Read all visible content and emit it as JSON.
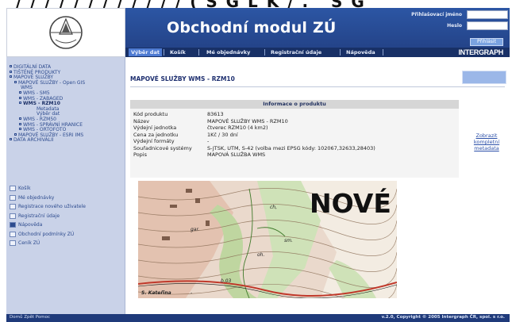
{
  "banner": {
    "text": "/ / / / / / / / / / / / ( S G L K / .   S G"
  },
  "app": {
    "title": "Obchodní modul ZÚ",
    "brand": "INTERGRAPH"
  },
  "login": {
    "username_label": "Přihlašovací jméno",
    "password_label": "Heslo",
    "submit_label": "Přihlásit"
  },
  "nav": {
    "items": [
      {
        "label": "Výběr dat",
        "active": true
      },
      {
        "label": "Košík"
      },
      {
        "label": "Mé objednávky"
      },
      {
        "label": "Registrační údaje"
      },
      {
        "label": "Nápověda"
      }
    ]
  },
  "sidebar": {
    "tree": [
      {
        "label": "DIGITÁLNÍ DATA"
      },
      {
        "label": "TIŠTĚNÉ PRODUKTY"
      },
      {
        "label": "MAPOVÉ SLUŽBY"
      },
      {
        "label": "MAPOVÉ SLUŽBY - Open GIS"
      },
      {
        "label": "WMS"
      },
      {
        "label": "WMS - SM5"
      },
      {
        "label": "WMS - ZABAGED"
      },
      {
        "label": "WMS - RZM10"
      },
      {
        "label": "Metadata"
      },
      {
        "label": "Výběr dat"
      },
      {
        "label": "WMS - RZM50"
      },
      {
        "label": "WMS - SPRÁVNÍ HRANICE"
      },
      {
        "label": "WMS - ORTOFOTO"
      },
      {
        "label": "MAPOVÉ SLUŽBY - ESRI IMS"
      },
      {
        "label": "DATA ARCHIVÁLIÍ"
      }
    ],
    "links": [
      {
        "label": "Košík"
      },
      {
        "label": "Mé objednávky"
      },
      {
        "label": "Registrace nového uživatele"
      },
      {
        "label": "Registrační údaje"
      },
      {
        "label": "Nápověda"
      },
      {
        "label": "Obchodní podmínky ZÚ"
      },
      {
        "label": "Ceník ZÚ"
      }
    ]
  },
  "main": {
    "page_title": "MAPOVÉ SLUŽBY WMS - RZM10",
    "info_header": "Informace o produktu",
    "rows": [
      {
        "key": "Kód produktu",
        "value": "83613"
      },
      {
        "key": "Název",
        "value": "MAPOVÉ SLUŽBY WMS - RZM10"
      },
      {
        "key": "Výdejní jednotka",
        "value": "čtverec RZM10 (4 km2)"
      },
      {
        "key": "Cena za jednotku",
        "value": "1Kč / 30 dní"
      },
      {
        "key": "Výdejní formáty",
        "value": "-"
      },
      {
        "key": "Souřadnicové systémy",
        "value": "S-JTSK, UTM, S-42 (volba mezi EPSG kódy: 102067,32633,28403)"
      },
      {
        "key": "Popis",
        "value": "MAPOVÁ SLUŽBA WMS"
      }
    ],
    "metadata_link": "Zobrazit kompletní metadata",
    "map": {
      "stamp": "NOVÉ",
      "labels": [
        "gar.",
        "ch,",
        "oh.",
        "sm.",
        "S. Kateřina",
        "-",
        "b.03"
      ]
    }
  },
  "footer": {
    "left": "Domů  Zpět  Pomoc",
    "right": "v.2.0, Copyright © 2005 Intergraph ČR, spol. s r.o."
  },
  "colors": {
    "header": "#2b4f9a",
    "navbar": "#183066",
    "sidebar": "#c9d2e8",
    "footer": "#1f3a7a"
  }
}
